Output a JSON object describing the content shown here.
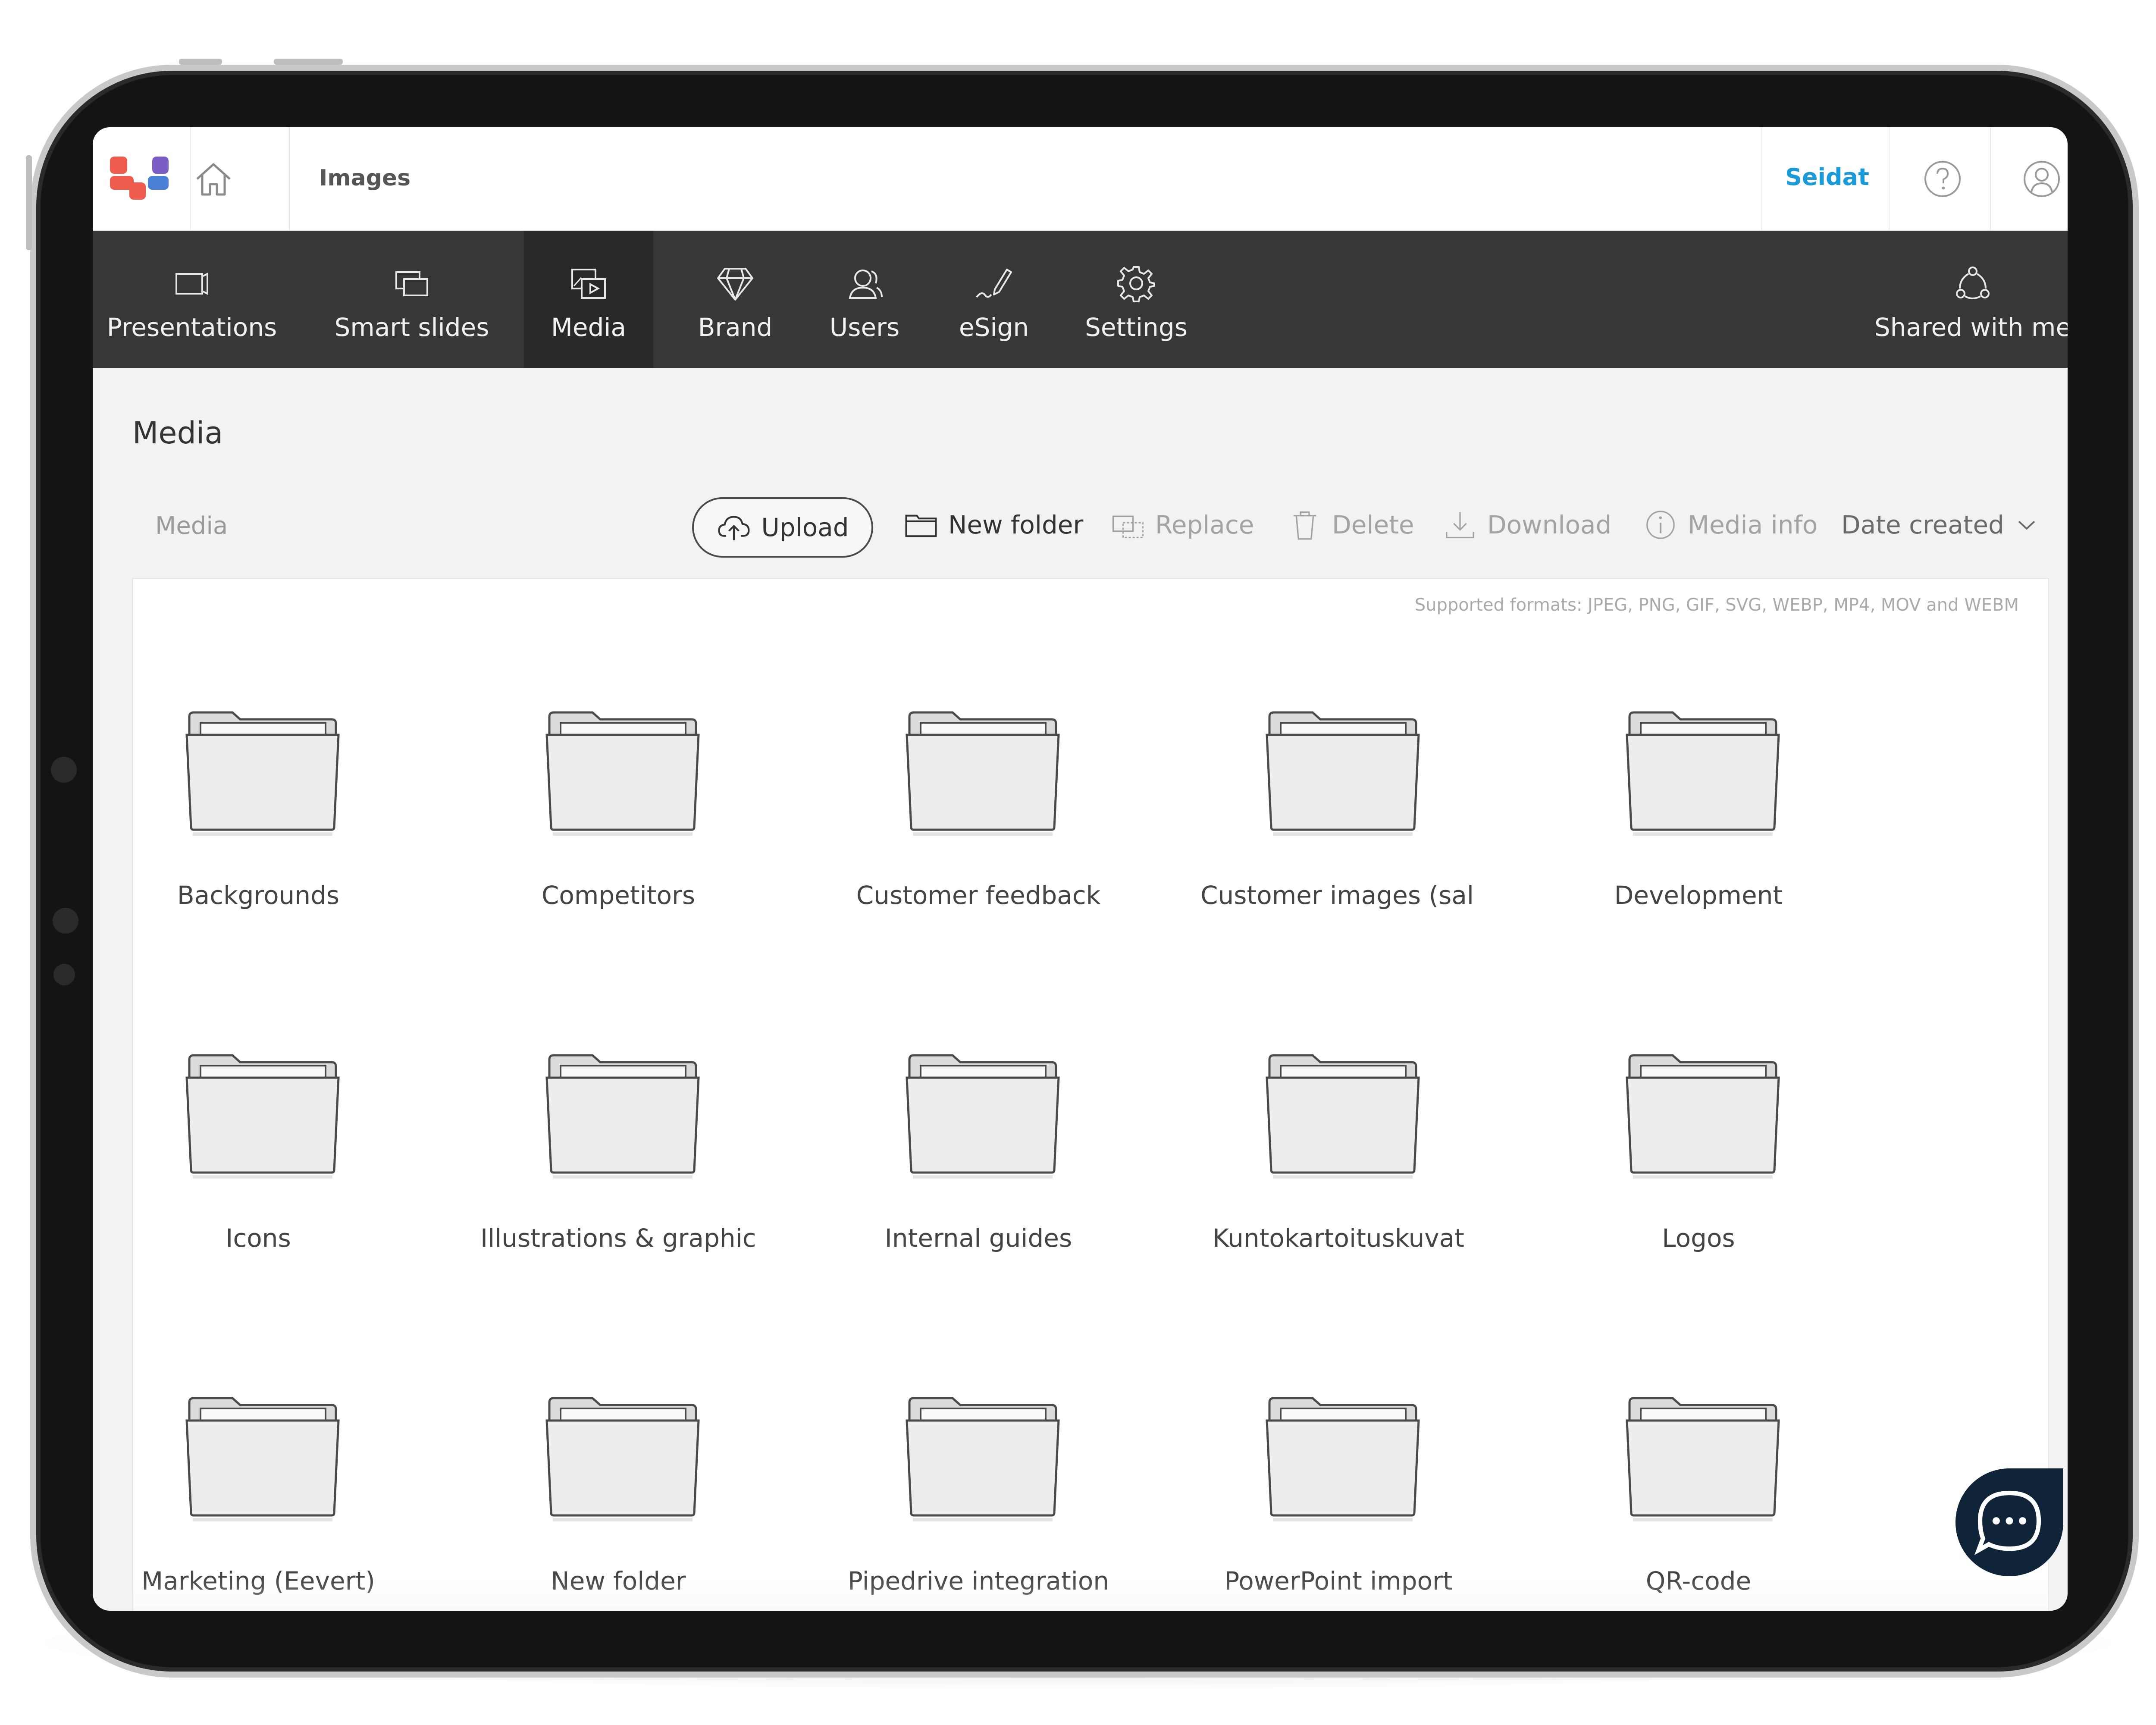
{
  "header": {
    "title": "Images",
    "org_name": "Seidat",
    "logo_colors": [
      "#ef5b4c",
      "#4a7fd6",
      "#7b5cc4"
    ]
  },
  "nav": {
    "items": [
      {
        "label": "Presentations",
        "icon": "presentation-icon"
      },
      {
        "label": "Smart slides",
        "icon": "smart-slides-icon"
      },
      {
        "label": "Media",
        "icon": "media-icon",
        "active": true
      },
      {
        "label": "Brand",
        "icon": "diamond-icon"
      },
      {
        "label": "Users",
        "icon": "users-icon"
      },
      {
        "label": "eSign",
        "icon": "pen-icon"
      },
      {
        "label": "Settings",
        "icon": "gear-icon"
      }
    ],
    "shared": {
      "label": "Shared with me",
      "icon": "share-icon"
    }
  },
  "page": {
    "title": "Media",
    "breadcrumb": "Media"
  },
  "toolbar": {
    "upload": "Upload",
    "new_folder": "New folder",
    "replace": "Replace",
    "delete": "Delete",
    "download": "Download",
    "media_info": "Media info",
    "sort": "Date created"
  },
  "content": {
    "formats_note": "Supported formats: JPEG, PNG, GIF, SVG, WEBP, MP4, MOV and WEBM",
    "folders": [
      "Backgrounds",
      "Competitors",
      "Customer feedback",
      "Customer images (sal...",
      "Development",
      "Icons",
      "Illustrations & graphics",
      "Internal guides",
      "Kuntokartoituskuvat",
      "Logos",
      "Marketing (Eevert)",
      "New folder",
      "Pipedrive integration",
      "PowerPoint import",
      "QR-code"
    ]
  },
  "colors": {
    "nav_bg": "#353739",
    "nav_active": "#27292b",
    "accent": "#1a9ad6",
    "chat_bg": "#0f2438"
  }
}
